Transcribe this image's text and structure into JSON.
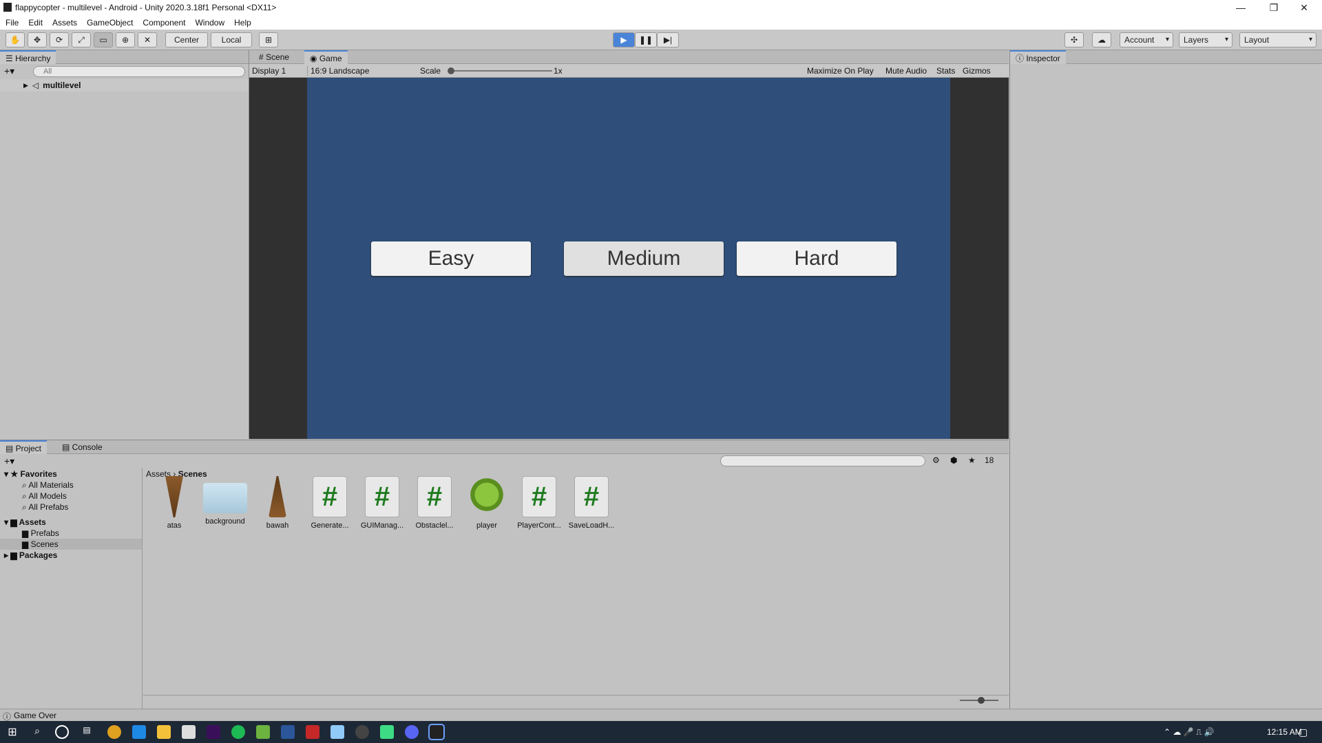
{
  "window": {
    "title": "flappycopter - multilevel - Android - Unity 2020.3.18f1 Personal <DX11>"
  },
  "menu": [
    "File",
    "Edit",
    "Assets",
    "GameObject",
    "Component",
    "Window",
    "Help"
  ],
  "toolbar": {
    "center_label": "Center",
    "local_label": "Local",
    "account_label": "Account",
    "layers_label": "Layers",
    "layout_label": "Layout"
  },
  "hierarchy": {
    "tab": "Hierarchy",
    "search_placeholder": "All",
    "root": "multilevel"
  },
  "scene_tabs": {
    "scene": "Scene",
    "game": "Game"
  },
  "game_bar": {
    "display": "Display 1",
    "aspect": "16:9 Landscape",
    "scale_label": "Scale",
    "scale_value": "1x",
    "maximize": "Maximize On Play",
    "mute": "Mute Audio",
    "stats": "Stats",
    "gizmos": "Gizmos"
  },
  "game": {
    "bg_color": "#2f4e7a",
    "buttons": [
      "Easy",
      "Medium",
      "Hard"
    ]
  },
  "inspector": {
    "tab": "Inspector"
  },
  "project": {
    "tab_project": "Project",
    "tab_console": "Console",
    "hidden_count": "18",
    "favorites": {
      "label": "Favorites",
      "items": [
        "All Materials",
        "All Models",
        "All Prefabs"
      ]
    },
    "assets": {
      "label": "Assets",
      "items": [
        "Prefabs",
        "Scenes"
      ]
    },
    "packages": "Packages",
    "breadcrumb": [
      "Assets",
      "Scenes"
    ],
    "files": [
      {
        "name": "atas",
        "kind": "sprite"
      },
      {
        "name": "background",
        "kind": "sprite"
      },
      {
        "name": "bawah",
        "kind": "sprite"
      },
      {
        "name": "Generate...",
        "kind": "script"
      },
      {
        "name": "GUIManag...",
        "kind": "script"
      },
      {
        "name": "Obstaclel...",
        "kind": "script"
      },
      {
        "name": "player",
        "kind": "prefab"
      },
      {
        "name": "PlayerCont...",
        "kind": "script"
      },
      {
        "name": "SaveLoadH...",
        "kind": "script"
      }
    ]
  },
  "status": {
    "message": "Game Over"
  },
  "taskbar": {
    "time": "12:15 AM"
  }
}
